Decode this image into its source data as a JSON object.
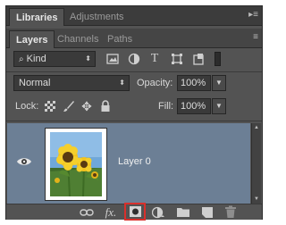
{
  "top_tabs": [
    {
      "label": "Libraries",
      "active": true
    },
    {
      "label": "Adjustments",
      "active": false
    }
  ],
  "panel_tabs": [
    {
      "label": "Layers",
      "active": true
    },
    {
      "label": "Channels",
      "active": false
    },
    {
      "label": "Paths",
      "active": false
    }
  ],
  "filter": {
    "value": "Kind"
  },
  "blend": {
    "mode": "Normal",
    "opacity_label": "Opacity:",
    "opacity_value": "100%"
  },
  "lock": {
    "label": "Lock:",
    "fill_label": "Fill:",
    "fill_value": "100%"
  },
  "layer": {
    "name": "Layer 0"
  },
  "colors": {
    "selected_row": "#6c7f95",
    "highlight": "#d9302c",
    "panel_bg": "#535353"
  }
}
